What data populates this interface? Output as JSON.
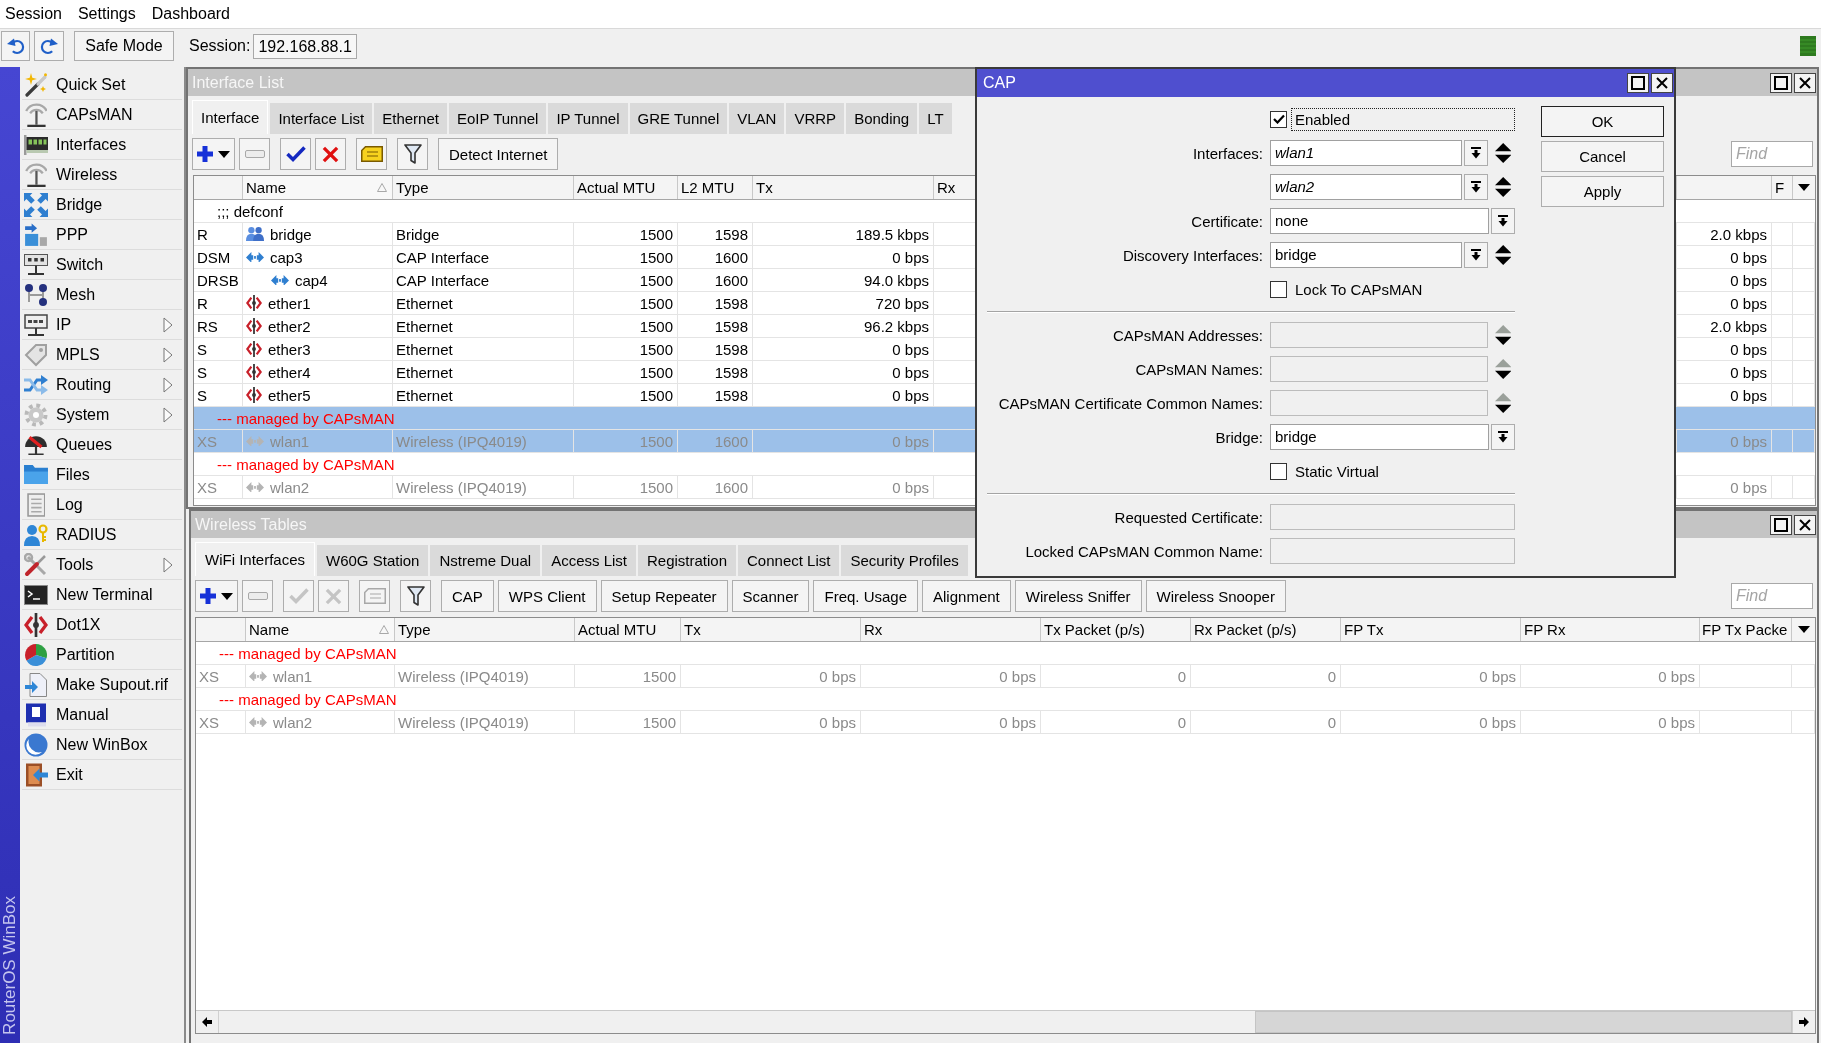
{
  "menu_bar": {
    "items": [
      "Session",
      "Settings",
      "Dashboard"
    ]
  },
  "toolbar": {
    "safe_mode": {
      "label": "Safe Mode",
      "on": false
    },
    "session": {
      "label": "Session:",
      "value": "192.168.88.1"
    }
  },
  "side_banner": {
    "text": "RouterOS WinBox"
  },
  "sidebar": {
    "items": [
      {
        "label": "Quick Set",
        "submenu": false
      },
      {
        "label": "CAPsMAN",
        "submenu": false
      },
      {
        "label": "Interfaces",
        "submenu": false
      },
      {
        "label": "Wireless",
        "submenu": false
      },
      {
        "label": "Bridge",
        "submenu": false
      },
      {
        "label": "PPP",
        "submenu": false
      },
      {
        "label": "Switch",
        "submenu": false
      },
      {
        "label": "Mesh",
        "submenu": false
      },
      {
        "label": "IP",
        "submenu": true
      },
      {
        "label": "MPLS",
        "submenu": true
      },
      {
        "label": "Routing",
        "submenu": true
      },
      {
        "label": "System",
        "submenu": true
      },
      {
        "label": "Queues",
        "submenu": false
      },
      {
        "label": "Files",
        "submenu": false
      },
      {
        "label": "Log",
        "submenu": false
      },
      {
        "label": "RADIUS",
        "submenu": false
      },
      {
        "label": "Tools",
        "submenu": true
      },
      {
        "label": "New Terminal",
        "submenu": false
      },
      {
        "label": "Dot1X",
        "submenu": false
      },
      {
        "label": "Partition",
        "submenu": false
      },
      {
        "label": "Make Supout.rif",
        "submenu": false
      },
      {
        "label": "Manual",
        "submenu": false
      },
      {
        "label": "New WinBox",
        "submenu": false
      },
      {
        "label": "Exit",
        "submenu": false
      }
    ]
  },
  "interface_list": {
    "title": "Interface List",
    "tabs": [
      {
        "label": "Interface",
        "selected": true
      },
      {
        "label": "Interface List",
        "selected": false
      },
      {
        "label": "Ethernet",
        "selected": false
      },
      {
        "label": "EoIP Tunnel",
        "selected": false
      },
      {
        "label": "IP Tunnel",
        "selected": false
      },
      {
        "label": "GRE Tunnel",
        "selected": false
      },
      {
        "label": "VLAN",
        "selected": false
      },
      {
        "label": "VRRP",
        "selected": false
      },
      {
        "label": "Bonding",
        "selected": false
      },
      {
        "label": "LT",
        "selected": false
      }
    ],
    "toolbar": [
      {
        "kind": "add",
        "disabled": false
      },
      {
        "kind": "remove",
        "disabled": true
      },
      {
        "kind": "enable",
        "disabled": false
      },
      {
        "kind": "disable",
        "disabled": false
      },
      {
        "kind": "comment",
        "disabled": false
      },
      {
        "kind": "filter",
        "disabled": false
      },
      {
        "kind": "text",
        "label": "Detect Internet",
        "disabled": false
      }
    ],
    "find": {
      "placeholder": "Find"
    },
    "columns": [
      {
        "label": "Name",
        "sorted": true
      },
      {
        "label": "Type",
        "sorted": false
      },
      {
        "label": "Actual MTU",
        "sorted": false
      },
      {
        "label": "L2 MTU",
        "sorted": false
      },
      {
        "label": "Tx",
        "sorted": false
      },
      {
        "label": "Rx",
        "sorted": false
      },
      {
        "label": "F",
        "sorted": false
      }
    ],
    "rows": [
      {
        "comment": {
          "kind": "config",
          "text": ";;; defconf"
        },
        "flags": "R",
        "name": "bridge",
        "kind": "bridge",
        "type": "Bridge",
        "actual_mtu": "1500",
        "l2_mtu": "1598",
        "tx": "189.5 kbps",
        "column_8": "2.0 kbps",
        "selected": false,
        "disabled": false
      },
      {
        "flags": "DSM",
        "name": "cap3",
        "kind": "cap",
        "type": "CAP Interface",
        "actual_mtu": "1500",
        "l2_mtu": "1600",
        "tx": "0 bps",
        "column_8": "0 bps",
        "selected": false,
        "disabled": false,
        "children": [
          {
            "flags": "DRSB",
            "name": "cap4",
            "kind": "cap",
            "type": "CAP Interface",
            "actual_mtu": "1500",
            "l2_mtu": "1600",
            "tx": "94.0 kbps",
            "column_8": "0 bps",
            "selected": false,
            "disabled": false
          }
        ]
      },
      {
        "flags": "R",
        "name": "ether1",
        "kind": "ethernet",
        "type": "Ethernet",
        "actual_mtu": "1500",
        "l2_mtu": "1598",
        "tx": "720 bps",
        "column_8": "0 bps",
        "selected": false,
        "disabled": false
      },
      {
        "flags": "RS",
        "name": "ether2",
        "kind": "ethernet",
        "type": "Ethernet",
        "actual_mtu": "1500",
        "l2_mtu": "1598",
        "tx": "96.2 kbps",
        "column_8": "2.0 kbps",
        "selected": false,
        "disabled": false
      },
      {
        "flags": "S",
        "name": "ether3",
        "kind": "ethernet",
        "type": "Ethernet",
        "actual_mtu": "1500",
        "l2_mtu": "1598",
        "tx": "0 bps",
        "column_8": "0 bps",
        "selected": false,
        "disabled": false
      },
      {
        "flags": "S",
        "name": "ether4",
        "kind": "ethernet",
        "type": "Ethernet",
        "actual_mtu": "1500",
        "l2_mtu": "1598",
        "tx": "0 bps",
        "column_8": "0 bps",
        "selected": false,
        "disabled": false
      },
      {
        "flags": "S",
        "name": "ether5",
        "kind": "ethernet",
        "type": "Ethernet",
        "actual_mtu": "1500",
        "l2_mtu": "1598",
        "tx": "0 bps",
        "column_8": "0 bps",
        "selected": false,
        "disabled": false
      },
      {
        "comment": {
          "kind": "managed",
          "text": "--- managed by CAPsMAN"
        },
        "flags": "XS",
        "name": "wlan1",
        "kind": "wireless",
        "type": "Wireless (IPQ4019)",
        "actual_mtu": "1500",
        "l2_mtu": "1600",
        "tx": "0 bps",
        "column_8": "0 bps",
        "selected": true,
        "disabled": true
      },
      {
        "comment": {
          "kind": "managed",
          "text": "--- managed by CAPsMAN"
        },
        "flags": "XS",
        "name": "wlan2",
        "kind": "wireless",
        "type": "Wireless (IPQ4019)",
        "actual_mtu": "1500",
        "l2_mtu": "1600",
        "tx": "0 bps",
        "column_8": "0 bps",
        "selected": false,
        "disabled": true
      }
    ]
  },
  "cap_dialog": {
    "title": "CAP",
    "fields": [
      {
        "kind": "checkbox",
        "label": "Enabled",
        "checked": true,
        "focused": true
      },
      {
        "kind": "multi-select",
        "label": "Interfaces:",
        "values": [
          {
            "text": "wlan1",
            "unlisted": true
          },
          {
            "text": "wlan2",
            "unlisted": true
          }
        ]
      },
      {
        "kind": "select",
        "label": "Certificate:",
        "value": "none"
      },
      {
        "kind": "multi-select",
        "label": "Discovery Interfaces:",
        "values": [
          {
            "text": "bridge",
            "unlisted": false
          }
        ]
      },
      {
        "kind": "checkbox",
        "label": "Lock To CAPsMAN",
        "checked": false,
        "focused": false
      },
      {
        "kind": "separator"
      },
      {
        "kind": "multi-text",
        "label": "CAPsMAN Addresses:"
      },
      {
        "kind": "multi-text",
        "label": "CAPsMAN Names:"
      },
      {
        "kind": "multi-text",
        "label": "CAPsMAN Certificate Common Names:"
      },
      {
        "kind": "select",
        "label": "Bridge:",
        "value": "bridge"
      },
      {
        "kind": "checkbox",
        "label": "Static Virtual",
        "checked": false,
        "focused": false
      },
      {
        "kind": "separator"
      },
      {
        "kind": "readonly",
        "label": "Requested Certificate:"
      },
      {
        "kind": "readonly",
        "label": "Locked CAPsMAN Common Name:"
      }
    ],
    "buttons": [
      {
        "label": "OK",
        "default": true
      },
      {
        "label": "Cancel",
        "default": false
      },
      {
        "label": "Apply",
        "default": false
      }
    ]
  },
  "wireless_tables": {
    "title": "Wireless Tables",
    "tabs": [
      {
        "label": "WiFi Interfaces",
        "selected": true
      },
      {
        "label": "W60G Station",
        "selected": false
      },
      {
        "label": "Nstreme Dual",
        "selected": false
      },
      {
        "label": "Access List",
        "selected": false
      },
      {
        "label": "Registration",
        "selected": false
      },
      {
        "label": "Connect List",
        "selected": false
      },
      {
        "label": "Security Profiles",
        "selected": false
      }
    ],
    "toolbar": [
      {
        "kind": "add",
        "disabled": false
      },
      {
        "kind": "remove",
        "disabled": true
      },
      {
        "kind": "enable",
        "disabled": true
      },
      {
        "kind": "disable",
        "disabled": true
      },
      {
        "kind": "comment",
        "disabled": true
      },
      {
        "kind": "filter",
        "disabled": false
      },
      {
        "kind": "text",
        "label": "CAP",
        "disabled": false
      },
      {
        "kind": "text",
        "label": "WPS Client",
        "disabled": false
      },
      {
        "kind": "text",
        "label": "Setup Repeater",
        "disabled": false
      },
      {
        "kind": "text",
        "label": "Scanner",
        "disabled": false
      },
      {
        "kind": "text",
        "label": "Freq. Usage",
        "disabled": false
      },
      {
        "kind": "text",
        "label": "Alignment",
        "disabled": false
      },
      {
        "kind": "text",
        "label": "Wireless Sniffer",
        "disabled": false
      },
      {
        "kind": "text",
        "label": "Wireless Snooper",
        "disabled": false
      }
    ],
    "find": {
      "placeholder": "Find"
    },
    "columns": [
      {
        "label": "Name",
        "sorted": true
      },
      {
        "label": "Type",
        "sorted": false
      },
      {
        "label": "Actual MTU",
        "sorted": false
      },
      {
        "label": "Tx",
        "sorted": false
      },
      {
        "label": "Rx",
        "sorted": false
      },
      {
        "label": "Tx Packet (p/s)",
        "sorted": false
      },
      {
        "label": "Rx Packet (p/s)",
        "sorted": false
      },
      {
        "label": "FP Tx",
        "sorted": false
      },
      {
        "label": "FP Rx",
        "sorted": false
      },
      {
        "label": "FP Tx Packe",
        "sorted": false
      }
    ],
    "rows": [
      {
        "comment": {
          "kind": "managed",
          "text": "--- managed by CAPsMAN"
        },
        "flags": "XS",
        "name": "wlan1",
        "kind": "wireless",
        "type": "Wireless (IPQ4019)",
        "actual_mtu": "1500",
        "tx": "0 bps",
        "rx": "0 bps",
        "tx_packet": "0",
        "rx_packet": "0",
        "fp_tx": "0 bps",
        "fp_rx": "0 bps",
        "selected": false,
        "disabled": true
      },
      {
        "comment": {
          "kind": "managed",
          "text": "--- managed by CAPsMAN"
        },
        "flags": "XS",
        "name": "wlan2",
        "kind": "wireless",
        "type": "Wireless (IPQ4019)",
        "actual_mtu": "1500",
        "tx": "0 bps",
        "rx": "0 bps",
        "tx_packet": "0",
        "rx_packet": "0",
        "fp_tx": "0 bps",
        "fp_rx": "0 bps",
        "selected": false,
        "disabled": true
      }
    ]
  }
}
